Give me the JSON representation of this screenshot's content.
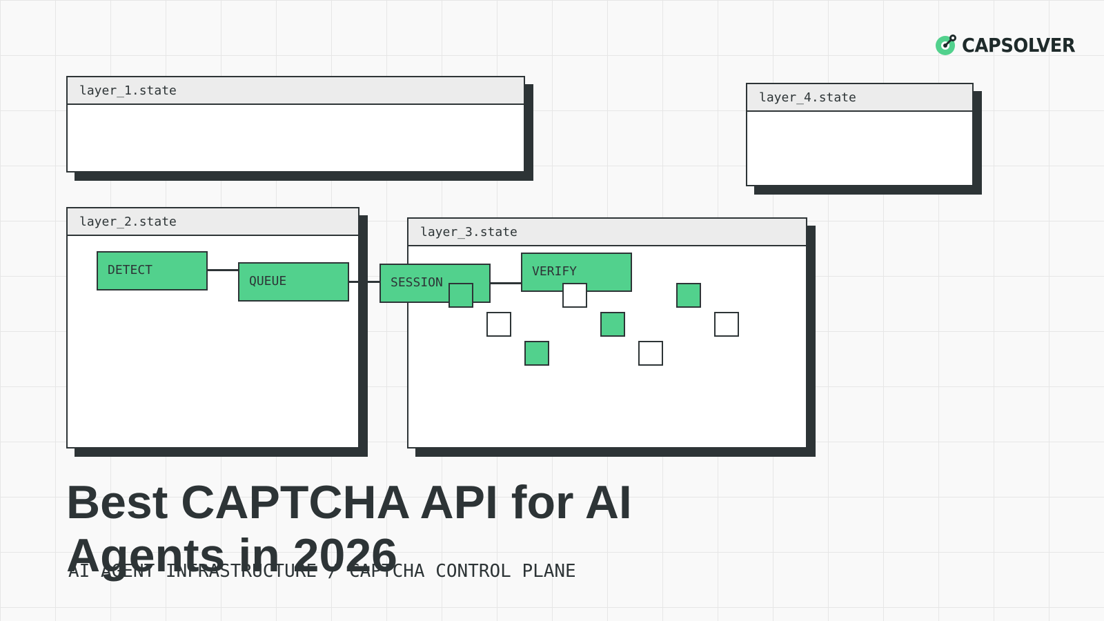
{
  "brand": {
    "name": "CAPSOLVER",
    "logo_icon": "capsolver-logo-icon",
    "accent_color": "#52d18d",
    "ink_color": "#2d3436"
  },
  "windows": {
    "layer_1": {
      "title": "layer_1.state"
    },
    "layer_2": {
      "title": "layer_2.state"
    },
    "layer_3": {
      "title": "layer_3.state"
    },
    "layer_4": {
      "title": "layer_4.state"
    }
  },
  "pipeline": {
    "nodes": [
      {
        "label": "DETECT"
      },
      {
        "label": "QUEUE"
      },
      {
        "label": "SESSION"
      },
      {
        "label": "VERIFY"
      }
    ]
  },
  "cells": [
    {
      "state": "on"
    },
    {
      "state": "off"
    },
    {
      "state": "on"
    },
    {
      "state": "off"
    },
    {
      "state": "on"
    },
    {
      "state": "off"
    },
    {
      "state": "on"
    },
    {
      "state": "off"
    }
  ],
  "headline": {
    "title": "Best CAPTCHA API for AI Agents in 2026",
    "subtitle": "AI AGENT INFRASTRUCTURE / CAPTCHA CONTROL PLANE"
  }
}
